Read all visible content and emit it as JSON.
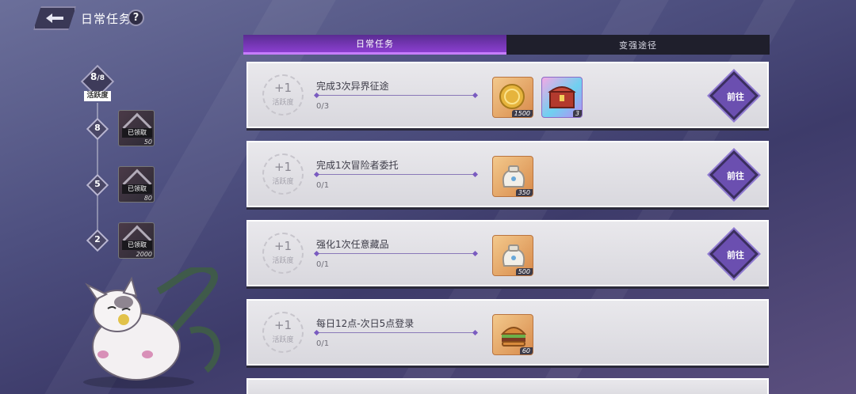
{
  "header": {
    "title": "日常任务",
    "help": "?"
  },
  "tabs": [
    {
      "label": "日常任务",
      "active": true
    },
    {
      "label": "变强途径",
      "active": false
    }
  ],
  "activity": {
    "current": "8",
    "total": "8",
    "label": "活跃度",
    "milestones": [
      {
        "threshold": "8",
        "status": "已领取",
        "qty": "50"
      },
      {
        "threshold": "5",
        "status": "已领取",
        "qty": "80"
      },
      {
        "threshold": "2",
        "status": "已领取",
        "qty": "2000"
      }
    ]
  },
  "tasks": [
    {
      "gain": "+1",
      "gain_label": "活跃度",
      "name": "完成3次异界征途",
      "progress": "0/3",
      "rewards": [
        {
          "icon": "gold-coin-icon",
          "qty": "1500"
        },
        {
          "icon": "treasure-chest-icon",
          "qty": "3"
        }
      ],
      "button": "前往"
    },
    {
      "gain": "+1",
      "gain_label": "活跃度",
      "name": "完成1次冒险者委托",
      "progress": "0/1",
      "rewards": [
        {
          "icon": "material-bag-icon",
          "qty": "350"
        }
      ],
      "button": "前往"
    },
    {
      "gain": "+1",
      "gain_label": "活跃度",
      "name": "强化1次任意藏品",
      "progress": "0/1",
      "rewards": [
        {
          "icon": "material-bag-icon",
          "qty": "500"
        }
      ],
      "button": "前往"
    },
    {
      "gain": "+1",
      "gain_label": "活跃度",
      "name": "每日12点-次日5点登录",
      "progress": "0/1",
      "rewards": [
        {
          "icon": "burger-icon",
          "qty": "60"
        }
      ],
      "button": ""
    }
  ],
  "colors": {
    "accent": "#8b3fd0",
    "button": "#6b4fb0",
    "background": "#4e5080"
  }
}
